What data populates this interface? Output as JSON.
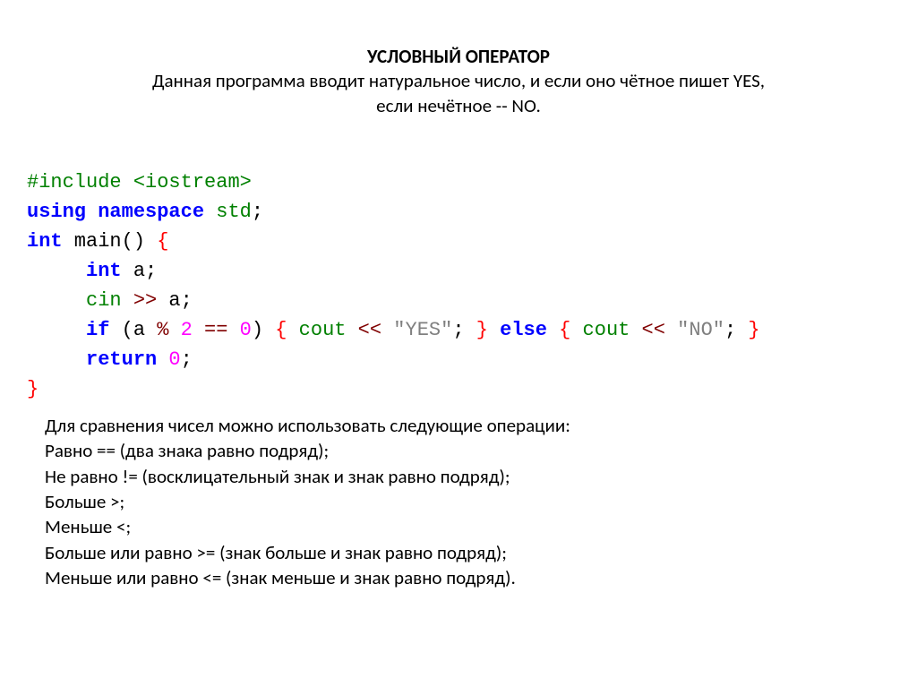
{
  "header": {
    "title": "УСЛОВНЫЙ ОПЕРАТОР",
    "line1": "Данная программа вводит натуральное число, и если оно чётное пишет YES,",
    "line2": "если нечётное -- NO."
  },
  "code": {
    "t_include_hash": "#include",
    "t_iostream": " <iostream>",
    "t_using": "using",
    "t_namespace": " namespace",
    "t_std": " std",
    "t_semi1": ";",
    "t_int": "int",
    "t_main": " main",
    "t_paren1": "()",
    "t_space1": " ",
    "t_brace_open1": "{",
    "t_indent": "     ",
    "t_int2": "int",
    "t_a": " a",
    "t_semi2": ";",
    "t_cin": "cin",
    "t_shr": " >>",
    "t_a2": " a",
    "t_semi3": ";",
    "t_if": "if",
    "t_lparen": " (",
    "t_cond_a": "a ",
    "t_pct": "% ",
    "t_two": "2",
    "t_eqeq": " == ",
    "t_zero": "0",
    "t_rparen": ")",
    "t_brace_open2": " { ",
    "t_cout1": "cout",
    "t_shl1": " << ",
    "t_yes": "\"YES\"",
    "t_semi4": ";",
    "t_brace_close2": " } ",
    "t_else": "else",
    "t_brace_open3": " { ",
    "t_cout2": "cout",
    "t_shl2": " << ",
    "t_no": "\"NO\"",
    "t_semi5": ";",
    "t_brace_close3": " }",
    "t_return": "return",
    "t_ret0": " 0",
    "t_semi6": ";",
    "t_brace_close1": "}"
  },
  "notes": {
    "intro": "Для сравнения чисел можно использовать следующие операции:",
    "l1": "Равно == (два знака равно подряд);",
    "l2": "Не равно != (восклицательный знак и знак равно подряд);",
    "l3": "Больше >;",
    "l4": "Меньше <;",
    "l5": "Больше или равно >= (знак больше и знак равно подряд);",
    "l6": "Меньше или равно <= (знак меньше и знак равно подряд)."
  }
}
